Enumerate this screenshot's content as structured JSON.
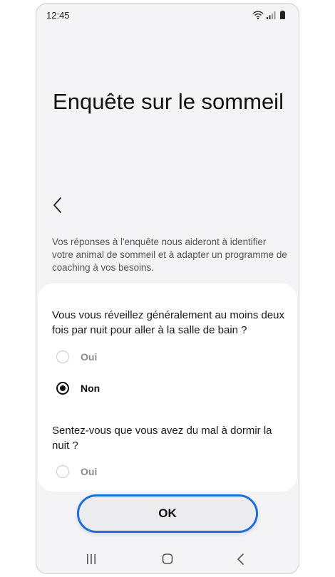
{
  "status_bar": {
    "time": "12:45",
    "icons": [
      "wifi-icon",
      "signal-icon",
      "battery-icon"
    ]
  },
  "page": {
    "title": "Enquête sur le sommeil",
    "intro": "Vos réponses à l'enquête nous aideront à identifier votre animal de sommeil et à adapter un programme de coaching à vos besoins."
  },
  "questions": [
    {
      "text": "Vous vous réveillez généralement au moins deux fois par nuit pour aller à la salle de bain ?",
      "options": [
        {
          "label": "Oui",
          "selected": false
        },
        {
          "label": "Non",
          "selected": true
        }
      ]
    },
    {
      "text": "Sentez-vous que vous avez du mal à dormir la nuit ?",
      "options": [
        {
          "label": "Oui",
          "selected": false
        }
      ]
    }
  ],
  "actions": {
    "ok_label": "OK"
  },
  "navigation": {
    "buttons": [
      "recent-apps-icon",
      "home-icon",
      "back-icon"
    ]
  },
  "colors": {
    "accent_outline": "#1e6fd9",
    "background": "#f4f4f6",
    "card": "#ffffff"
  }
}
